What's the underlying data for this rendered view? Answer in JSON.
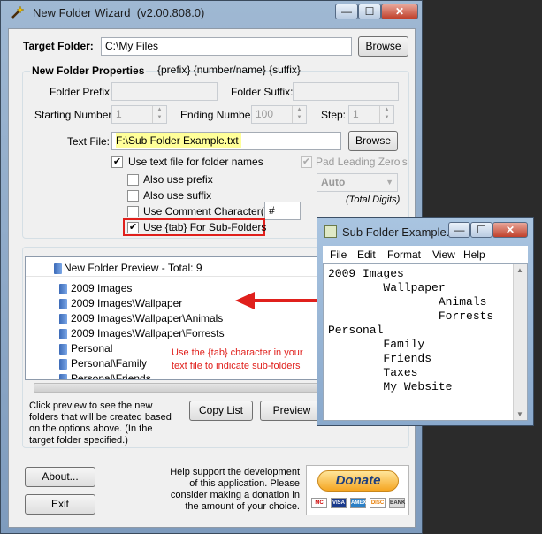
{
  "window": {
    "title": "New Folder Wizard",
    "version": "(v2.00.808.0)",
    "caption_min": "—",
    "caption_max": "☐",
    "caption_close": "✕"
  },
  "target": {
    "label": "Target Folder:",
    "value": "C:\\My Files",
    "browse": "Browse"
  },
  "props": {
    "heading": "New Folder Properties",
    "format_hint": "{prefix} {number/name} {suffix}",
    "prefix_label": "Folder Prefix:",
    "prefix_value": "",
    "suffix_label": "Folder Suffix:",
    "suffix_value": "",
    "start_label": "Starting Number:",
    "start_value": "1",
    "end_label": "Ending Number:",
    "end_value": "100",
    "step_label": "Step:",
    "step_value": "1",
    "textfile_label": "Text File:",
    "textfile_value": "F:\\Sub Folder Example.txt",
    "textfile_browse": "Browse",
    "use_text_file": "Use text file for folder names",
    "pad_leading": "Pad Leading Zero's",
    "also_prefix": "Also use prefix",
    "also_suffix": "Also use suffix",
    "use_comment": "Use Comment Character(s):",
    "comment_value": "#",
    "use_tab": "Use {tab} For Sub-Folders",
    "auto_value": "Auto",
    "total_digits": "(Total Digits)"
  },
  "preview": {
    "header": "New Folder Preview - Total: 9",
    "items": [
      "2009 Images",
      "2009 Images\\Wallpaper",
      "2009 Images\\Wallpaper\\Animals",
      "2009 Images\\Wallpaper\\Forrests",
      "Personal",
      "Personal\\Family",
      "Personal\\Friends"
    ],
    "annotation_line1": "Use the {tab} character in your",
    "annotation_line2": "text file to indicate sub-folders",
    "help_text": "Click preview to see the new folders that will be created based on the options above. (In the target folder specified.)",
    "copy_list": "Copy List",
    "preview_button": "Preview"
  },
  "bottom": {
    "about": "About...",
    "exit": "Exit",
    "support_text": "Help support the development of this application. Please consider making a donation in the amount of your choice.",
    "donate": "Donate",
    "cards": [
      "MC",
      "VISA",
      "AMEX",
      "DISC",
      "BANK"
    ]
  },
  "notepad": {
    "title": "Sub Folder Example...",
    "menu": [
      "File",
      "Edit",
      "Format",
      "View",
      "Help"
    ],
    "lines": [
      "2009 Images",
      "        Wallpaper",
      "                Animals",
      "                Forrests",
      "Personal",
      "        Family",
      "        Friends",
      "        Taxes",
      "        My Website"
    ]
  },
  "colors": {
    "annotation": "#e0201c",
    "highlight_yellow": "#ffff99",
    "accent_blue": "#3c6bb8"
  }
}
